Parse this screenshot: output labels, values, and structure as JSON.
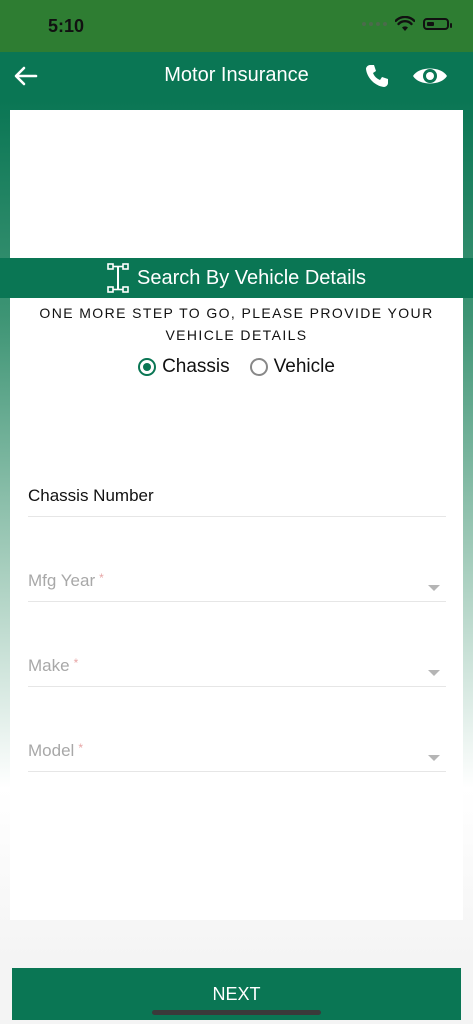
{
  "status_bar": {
    "time": "5:10"
  },
  "header": {
    "title": "Motor Insurance"
  },
  "search_section": {
    "label": "Search By Vehicle Details"
  },
  "instruction": {
    "line1": "ONE MORE STEP TO GO, PLEASE PROVIDE YOUR",
    "line2": "VEHICLE DETAILS"
  },
  "search_type": {
    "options": [
      {
        "label": "Chassis",
        "selected": true
      },
      {
        "label": "Vehicle",
        "selected": false
      }
    ]
  },
  "form": {
    "chassis_number": {
      "label": "Chassis Number"
    },
    "mfg_year": {
      "label": "Mfg Year",
      "required_mark": "*"
    },
    "make": {
      "label": "Make",
      "required_mark": "*"
    },
    "model": {
      "label": "Model",
      "required_mark": "*"
    }
  },
  "footer": {
    "next_label": "NEXT"
  },
  "colors": {
    "primary": "#0a7654",
    "status_bar": "#2e7d32"
  },
  "icons": {
    "back": "arrow-left-icon",
    "call": "phone-icon",
    "view": "eye-icon",
    "search_section": "car-chassis-icon"
  }
}
